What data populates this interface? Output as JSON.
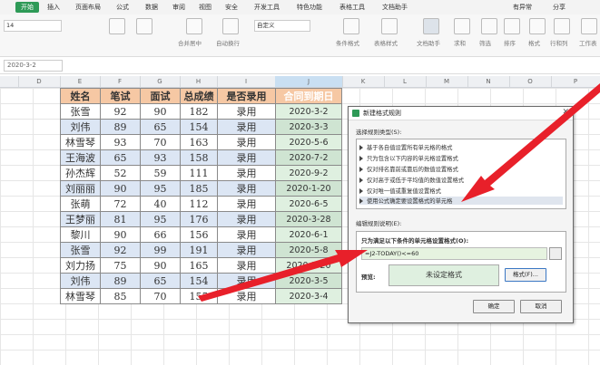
{
  "menubar": {
    "start": "开始",
    "items": [
      "插入",
      "页面布局",
      "公式",
      "数据",
      "审阅",
      "视图",
      "安全",
      "开发工具",
      "特色功能",
      "表格工具",
      "文档助手"
    ],
    "unsaved": "有异常",
    "share": "分享"
  },
  "toolbar": {
    "font_size": "14",
    "number_format": "自定义",
    "labels": [
      "合并居中",
      "自动换行",
      "条件格式",
      "表格样式",
      "文档助手",
      "求和",
      "筛选",
      "排序",
      "格式",
      "行和列",
      "工作表"
    ]
  },
  "formula_bar": {
    "name_box": "2020-3-2"
  },
  "columns": [
    "D",
    "E",
    "F",
    "G",
    "H",
    "I",
    "J",
    "K",
    "L",
    "M",
    "N",
    "O",
    "P"
  ],
  "table": {
    "headers": [
      "姓名",
      "笔试",
      "面试",
      "总成绩",
      "是否录用",
      "合同到期日"
    ],
    "rows": [
      [
        "张雪",
        "92",
        "90",
        "182",
        "录用",
        "2020-3-2"
      ],
      [
        "刘伟",
        "89",
        "65",
        "154",
        "录用",
        "2020-3-3"
      ],
      [
        "林雪琴",
        "93",
        "70",
        "163",
        "录用",
        "2020-5-6"
      ],
      [
        "王海波",
        "65",
        "93",
        "158",
        "录用",
        "2020-7-2"
      ],
      [
        "孙杰辉",
        "52",
        "59",
        "111",
        "录用",
        "2020-9-2"
      ],
      [
        "刘丽丽",
        "90",
        "95",
        "185",
        "录用",
        "2020-1-20"
      ],
      [
        "张萌",
        "72",
        "40",
        "112",
        "录用",
        "2020-6-5"
      ],
      [
        "王梦丽",
        "81",
        "95",
        "176",
        "录用",
        "2020-3-28"
      ],
      [
        "黎川",
        "90",
        "66",
        "156",
        "录用",
        "2020-6-1"
      ],
      [
        "张雪",
        "92",
        "99",
        "191",
        "录用",
        "2020-5-8"
      ],
      [
        "刘力扬",
        "75",
        "90",
        "165",
        "录用",
        "2020-3-20"
      ],
      [
        "刘伟",
        "89",
        "65",
        "154",
        "录用",
        "2020-3-5"
      ],
      [
        "林雪琴",
        "85",
        "70",
        "155",
        "录用",
        "2020-3-4"
      ]
    ]
  },
  "dialog": {
    "title": "新建格式规则",
    "rule_type_label": "选择规则类型(S):",
    "rule_types": [
      "基于各自值设置所有单元格的格式",
      "只为包含以下内容的单元格设置格式",
      "仅对排名靠前或靠后的数值设置格式",
      "仅对高于或低于平均值的数值设置格式",
      "仅对唯一值或重复值设置格式",
      "使用公式确定要设置格式的单元格"
    ],
    "edit_desc_label": "编辑规则说明(E):",
    "formula_label": "只为满足以下条件的单元格设置格式(O):",
    "formula_value": "=J2-TODAY()<=60",
    "preview_label": "预览:",
    "preview_text": "未设定格式",
    "format_button": "格式(F)...",
    "ok_button": "确定",
    "cancel_button": "取消",
    "accent_color": "#e8202a"
  }
}
